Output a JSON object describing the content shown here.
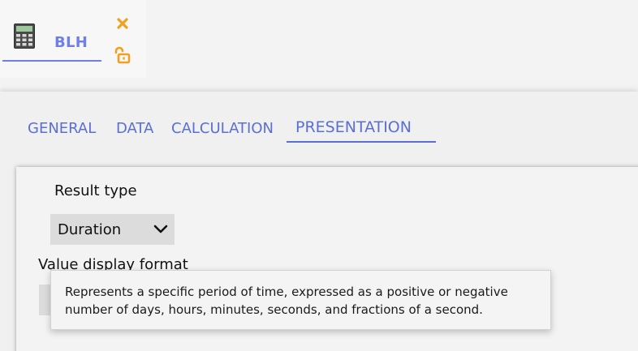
{
  "header": {
    "tab_label": "BLH",
    "icons": {
      "calculator": "calculator-icon",
      "close": "close-icon",
      "lock": "unlock-icon"
    },
    "accent_color": "#6f7fe8",
    "icon_color": "#f0a020"
  },
  "tabs": [
    {
      "label": "GENERAL",
      "active": false
    },
    {
      "label": "DATA",
      "active": false
    },
    {
      "label": "CALCULATION",
      "active": false
    },
    {
      "label": "PRESENTATION",
      "active": true
    }
  ],
  "presentation": {
    "result_type_label": "Result type",
    "result_type_value": "Duration",
    "value_display_format_label": "Value display format",
    "value_display_format_value": ""
  },
  "tooltip": {
    "line1": "Represents a specific period of time, expressed as a positive or negative",
    "line2": "number of days, hours, minutes, seconds, and fractions of a second."
  }
}
